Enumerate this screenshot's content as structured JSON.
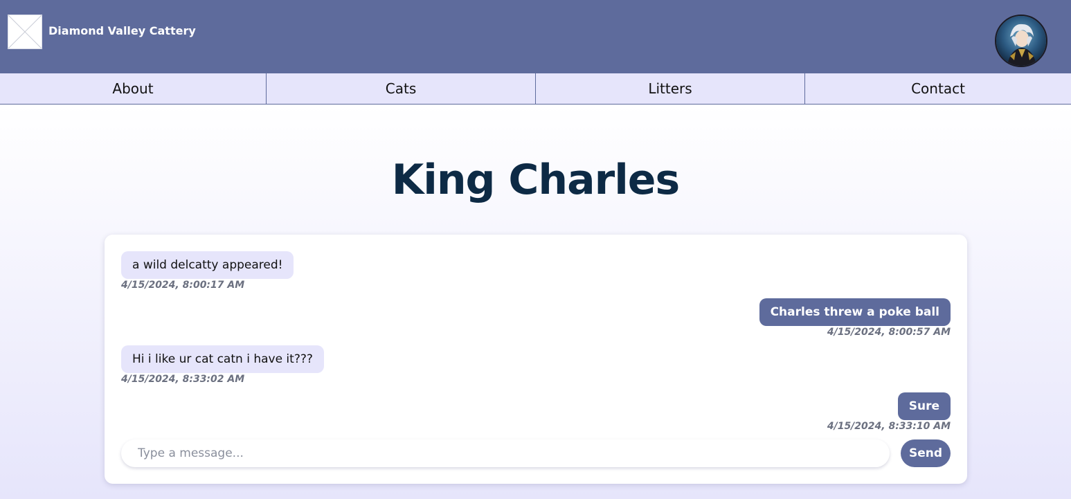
{
  "header": {
    "brand": "Diamond Valley Cattery",
    "logo_icon": "broken-image-icon",
    "avatar_icon": "user-avatar-icon"
  },
  "nav": {
    "items": [
      {
        "label": "About"
      },
      {
        "label": "Cats"
      },
      {
        "label": "Litters"
      },
      {
        "label": "Contact"
      }
    ]
  },
  "page": {
    "title": "King Charles"
  },
  "chat": {
    "messages": [
      {
        "text": "a wild delcatty appeared!",
        "time": "4/15/2024, 8:00:17 AM",
        "direction": "received"
      },
      {
        "text": "Charles threw a poke ball",
        "time": "4/15/2024, 8:00:57 AM",
        "direction": "sent"
      },
      {
        "text": "Hi i like ur cat catn i have it???",
        "time": "4/15/2024, 8:33:02 AM",
        "direction": "received"
      },
      {
        "text": "Sure",
        "time": "4/15/2024, 8:33:10 AM",
        "direction": "sent"
      }
    ],
    "input_placeholder": "Type a message...",
    "input_value": "",
    "send_label": "Send"
  },
  "colors": {
    "header_bg": "#5e6b9c",
    "nav_bg": "#e6e5fb",
    "title": "#0d2a45",
    "sent_bubble": "#5e6b9c",
    "received_bubble": "#e6e5fb"
  }
}
